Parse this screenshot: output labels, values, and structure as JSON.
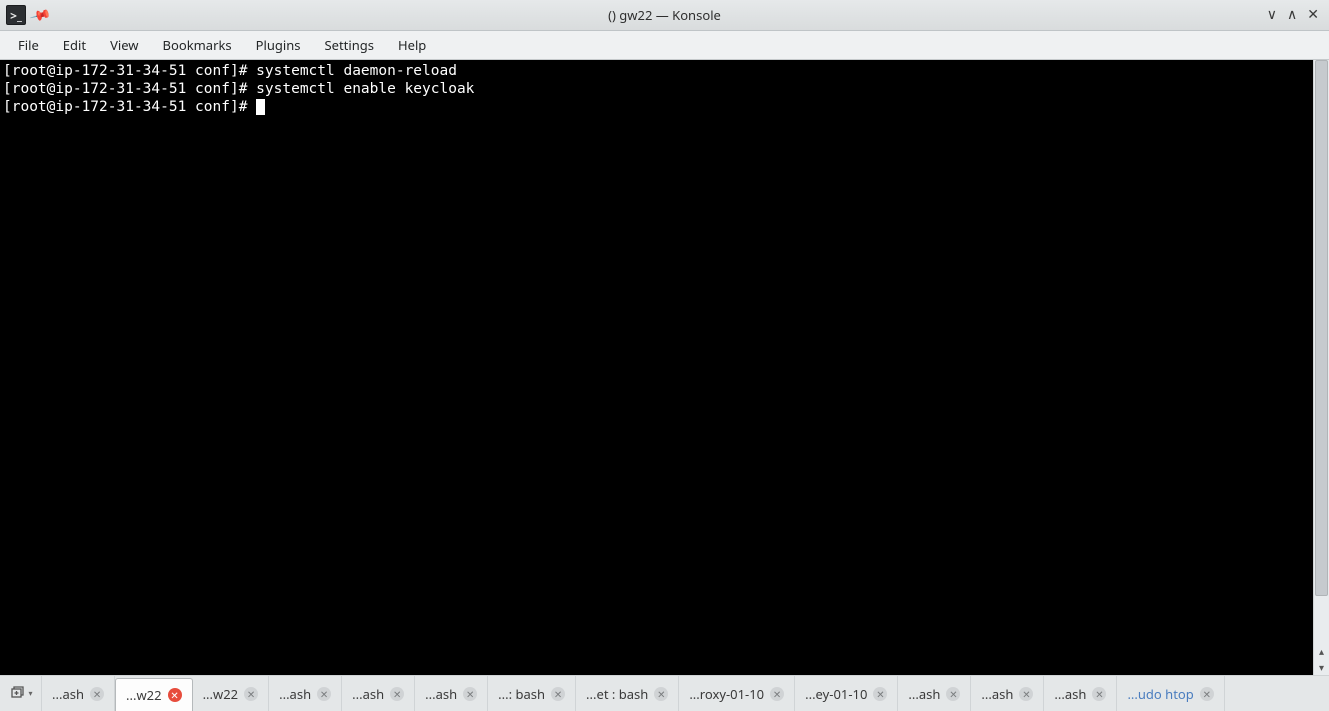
{
  "window": {
    "title": "() gw22 — Konsole"
  },
  "menu": {
    "items": [
      "File",
      "Edit",
      "View",
      "Bookmarks",
      "Plugins",
      "Settings",
      "Help"
    ]
  },
  "terminal": {
    "lines": [
      {
        "prompt": "[root@ip-172-31-34-51 conf]# ",
        "cmd": "systemctl daemon-reload"
      },
      {
        "prompt": "[root@ip-172-31-34-51 conf]# ",
        "cmd": "systemctl enable keycloak"
      },
      {
        "prompt": "[root@ip-172-31-34-51 conf]# ",
        "cmd": "",
        "cursor": true
      }
    ]
  },
  "tabs": {
    "items": [
      {
        "label": "...ash",
        "active": false,
        "closeStyle": "gray",
        "highlight": false
      },
      {
        "label": "...w22",
        "active": true,
        "closeStyle": "red",
        "highlight": false
      },
      {
        "label": "...w22",
        "active": false,
        "closeStyle": "gray",
        "highlight": false
      },
      {
        "label": "...ash",
        "active": false,
        "closeStyle": "gray",
        "highlight": false
      },
      {
        "label": "...ash",
        "active": false,
        "closeStyle": "gray",
        "highlight": false
      },
      {
        "label": "...ash",
        "active": false,
        "closeStyle": "gray",
        "highlight": false
      },
      {
        "label": "...: bash",
        "active": false,
        "closeStyle": "gray",
        "highlight": false
      },
      {
        "label": "...et : bash",
        "active": false,
        "closeStyle": "gray",
        "highlight": false
      },
      {
        "label": "...roxy-01-10",
        "active": false,
        "closeStyle": "gray",
        "highlight": false
      },
      {
        "label": "...ey-01-10",
        "active": false,
        "closeStyle": "gray",
        "highlight": false
      },
      {
        "label": "...ash",
        "active": false,
        "closeStyle": "gray",
        "highlight": false
      },
      {
        "label": "...ash",
        "active": false,
        "closeStyle": "gray",
        "highlight": false
      },
      {
        "label": "...ash",
        "active": false,
        "closeStyle": "gray",
        "highlight": false
      },
      {
        "label": "...udo htop",
        "active": false,
        "closeStyle": "gray",
        "highlight": true
      }
    ]
  }
}
